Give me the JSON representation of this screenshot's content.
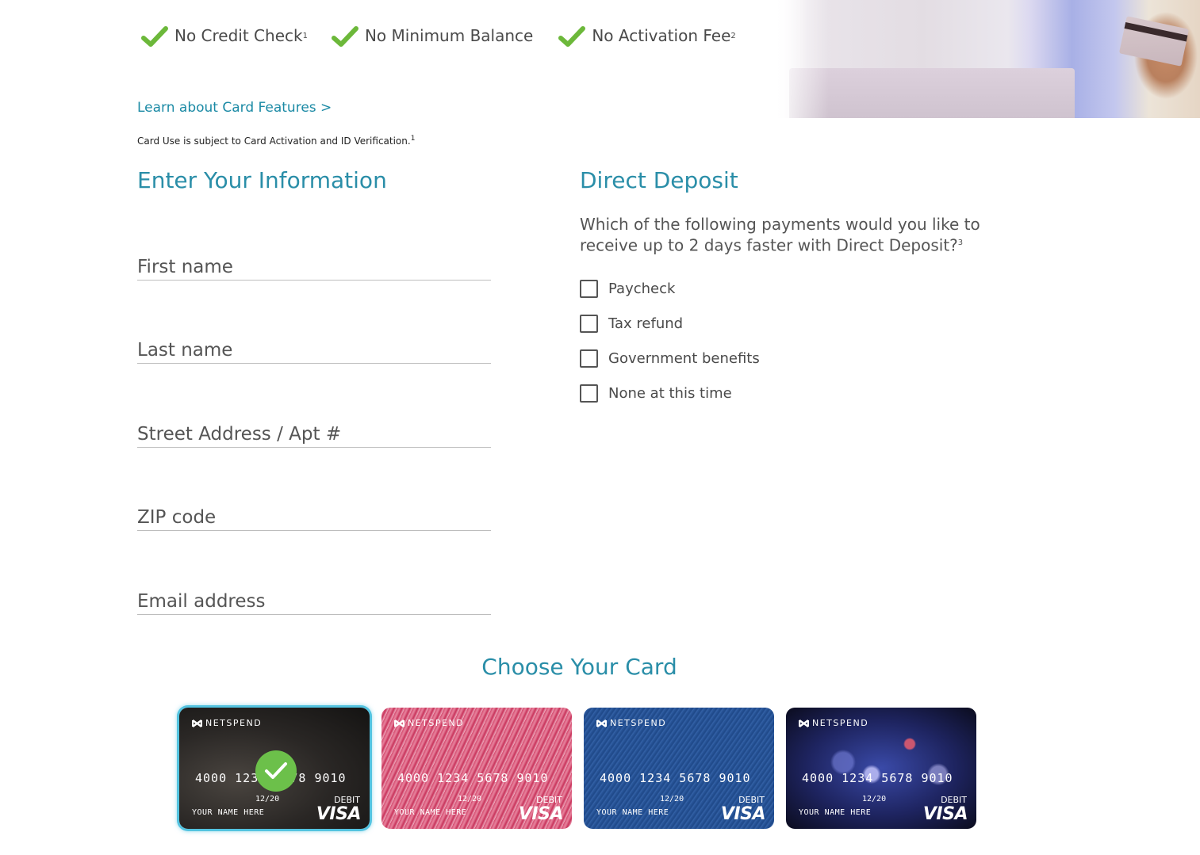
{
  "features": [
    {
      "label": "No Credit Check",
      "footnote": "1",
      "icon": "check-icon"
    },
    {
      "label": "No Minimum Balance",
      "footnote": "",
      "icon": "check-icon"
    },
    {
      "label": "No Activation Fee",
      "footnote": "2",
      "icon": "check-icon"
    }
  ],
  "learn_link": "Learn about Card Features >",
  "disclaimer": {
    "text": "Card Use is subject to Card Activation and ID Verification.",
    "footnote": "1"
  },
  "enter_info": {
    "title": "Enter Your Information",
    "fields": {
      "first_name": {
        "placeholder": "First name",
        "value": ""
      },
      "last_name": {
        "placeholder": "Last name",
        "value": ""
      },
      "street": {
        "placeholder": "Street Address / Apt #",
        "value": ""
      },
      "zip": {
        "placeholder": "ZIP code",
        "value": ""
      },
      "email": {
        "placeholder": "Email address",
        "value": ""
      }
    }
  },
  "direct_deposit": {
    "title": "Direct Deposit",
    "question": "Which of the following payments would you like to receive up to 2 days faster with Direct Deposit?",
    "footnote": "3",
    "options": [
      {
        "label": "Paycheck",
        "checked": false
      },
      {
        "label": "Tax refund",
        "checked": false
      },
      {
        "label": "Government benefits",
        "checked": false
      },
      {
        "label": "None at this time",
        "checked": false
      }
    ]
  },
  "choose_card": {
    "title": "Choose Your Card",
    "selected_index": 0,
    "cards": [
      {
        "design": "black",
        "brand": "NETSPEND",
        "number": "4000 1234 5678 9010",
        "expiry": "12/20",
        "name": "YOUR NAME HERE",
        "type": "DEBIT",
        "network": "VISA"
      },
      {
        "design": "pink",
        "brand": "NETSPEND",
        "number": "4000 1234 5678 9010",
        "expiry": "12/20",
        "name": "YOUR NAME HERE",
        "type": "DEBIT",
        "network": "VISA"
      },
      {
        "design": "blue",
        "brand": "NETSPEND",
        "number": "4000 1234 5678 9010",
        "expiry": "12/20",
        "name": "YOUR NAME HERE",
        "type": "DEBIT",
        "network": "VISA"
      },
      {
        "design": "navy-bokeh",
        "brand": "NETSPEND",
        "number": "4000 1234 5678 9010",
        "expiry": "12/20",
        "name": "YOUR NAME HERE",
        "type": "DEBIT",
        "network": "VISA"
      }
    ]
  },
  "colors": {
    "accent": "#2a8ea8",
    "link": "#1b8aa5",
    "check_green": "#6cc04a",
    "selected_glow": "#53c3e0"
  }
}
